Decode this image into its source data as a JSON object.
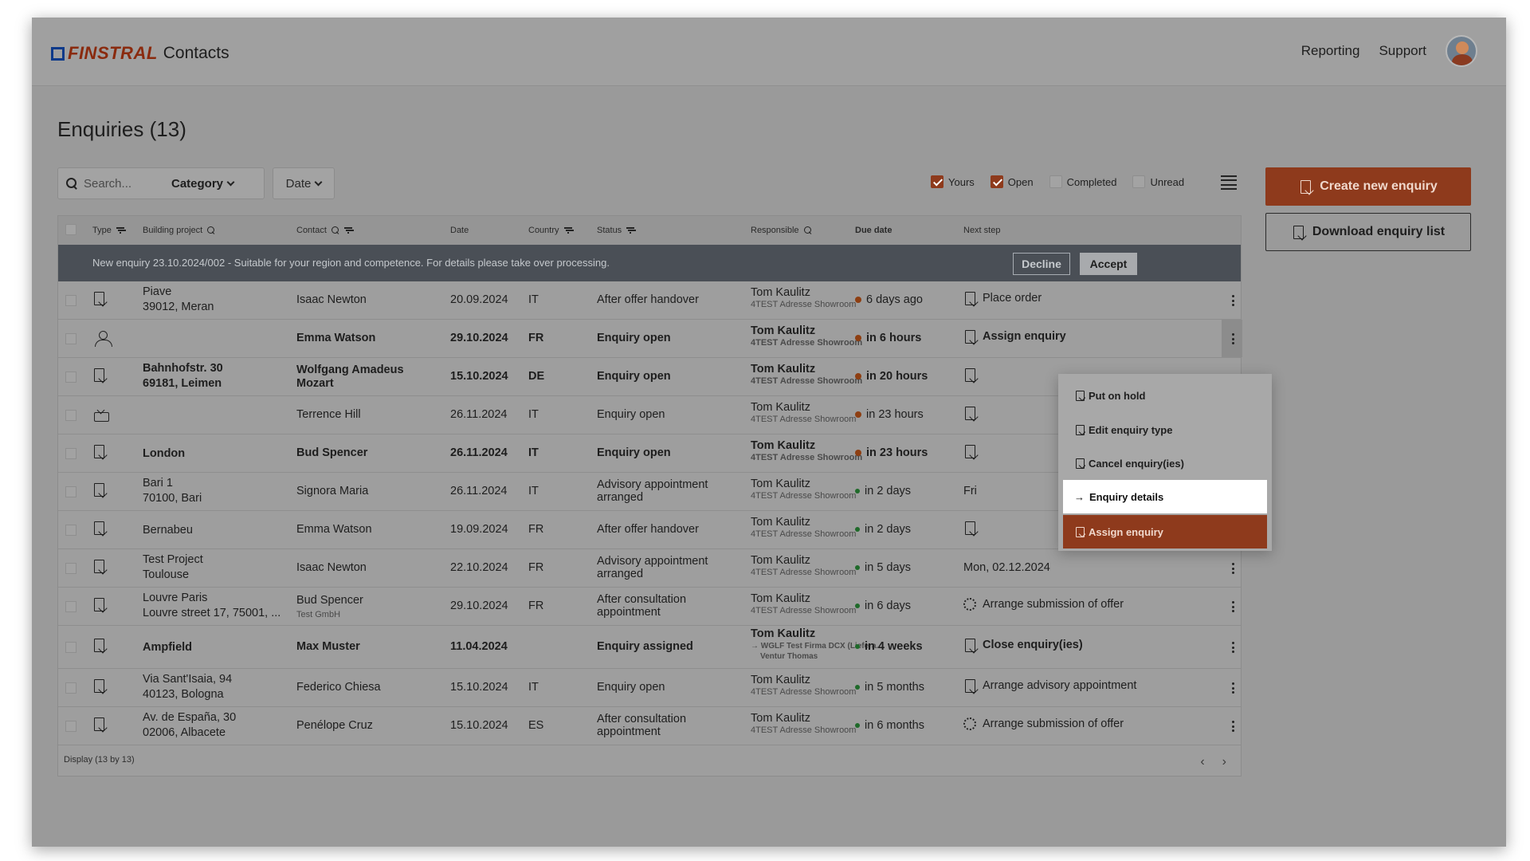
{
  "app": {
    "brand": "FINSTRAL",
    "name": "Contacts"
  },
  "nav": {
    "reporting": "Reporting",
    "support": "Support"
  },
  "page": {
    "title": "Enquiries (13)"
  },
  "filters": {
    "search_placeholder": "Search...",
    "category": "Category",
    "date": "Date",
    "yours": "Yours",
    "open": "Open",
    "completed": "Completed",
    "unread": "Unread"
  },
  "actions": {
    "create": "Create new enquiry",
    "download": "Download enquiry list"
  },
  "columns": {
    "type": "Type",
    "building": "Building project",
    "contact": "Contact",
    "date": "Date",
    "country": "Country",
    "status": "Status",
    "responsible": "Responsible",
    "due": "Due date",
    "next": "Next step"
  },
  "banner": {
    "message": "New enquiry 23.10.2024/002 - Suitable for your region and competence. For details please take over processing.",
    "decline": "Decline",
    "accept": "Accept"
  },
  "rows": [
    {
      "b1": "Piave",
      "b2": "39012, Meran",
      "contact": "Isaac Newton",
      "contact_sub": "",
      "date": "20.09.2024",
      "country": "IT",
      "s1": "After offer handover",
      "s2": "",
      "resp": "Tom Kaulitz",
      "resp_sub": "4TEST Adresse Showroom",
      "due": "6 days ago",
      "next": "Place order"
    },
    {
      "b1": "",
      "b2": "",
      "contact": "Emma Watson",
      "contact_sub": "",
      "date": "29.10.2024",
      "country": "FR",
      "s1": "Enquiry open",
      "s2": "",
      "resp": "Tom Kaulitz",
      "resp_sub": "4TEST Adresse Showroom",
      "due": "in 6 hours",
      "next": "Assign enquiry"
    },
    {
      "b1": "Bahnhofstr. 30",
      "b2": "69181, Leimen",
      "contact": "Wolfgang Amadeus",
      "contact_sub": "Mozart",
      "date": "15.10.2024",
      "country": "DE",
      "s1": "Enquiry open",
      "s2": "",
      "resp": "Tom Kaulitz",
      "resp_sub": "4TEST Adresse Showroom",
      "due": "in 20 hours",
      "next": ""
    },
    {
      "b1": "",
      "b2": "",
      "contact": "Terrence Hill",
      "contact_sub": "",
      "date": "26.11.2024",
      "country": "IT",
      "s1": "Enquiry open",
      "s2": "",
      "resp": "Tom Kaulitz",
      "resp_sub": "4TEST Adresse Showroom",
      "due": "in 23 hours",
      "next": ""
    },
    {
      "b1": "London",
      "b2": "",
      "contact": "Bud Spencer",
      "contact_sub": "",
      "date": "26.11.2024",
      "country": "IT",
      "s1": "Enquiry open",
      "s2": "",
      "resp": "Tom Kaulitz",
      "resp_sub": "4TEST Adresse Showroom",
      "due": "in 23 hours",
      "next": ""
    },
    {
      "b1": "Bari 1",
      "b2": "70100, Bari",
      "contact": "Signora Maria",
      "contact_sub": "",
      "date": "26.11.2024",
      "country": "IT",
      "s1": "Advisory appointment",
      "s2": "arranged",
      "resp": "Tom Kaulitz",
      "resp_sub": "4TEST Adresse Showroom",
      "due": "in 2 days",
      "next": "Fri"
    },
    {
      "b1": "Bernabeu",
      "b2": "",
      "contact": "Emma Watson",
      "contact_sub": "",
      "date": "19.09.2024",
      "country": "FR",
      "s1": "After offer handover",
      "s2": "",
      "resp": "Tom Kaulitz",
      "resp_sub": "4TEST Adresse Showroom",
      "due": "in 2 days",
      "next": ""
    },
    {
      "b1": "Test Project",
      "b2": "Toulouse",
      "contact": "Isaac Newton",
      "contact_sub": "",
      "date": "22.10.2024",
      "country": "FR",
      "s1": "Advisory appointment",
      "s2": "arranged",
      "resp": "Tom Kaulitz",
      "resp_sub": "4TEST Adresse Showroom",
      "due": "in 5 days",
      "next": "Mon, 02.12.2024"
    },
    {
      "b1": "Louvre Paris",
      "b2": "Louvre street 17, 75001, ...",
      "contact": "Bud Spencer",
      "contact_sub": "Test GmbH",
      "date": "29.10.2024",
      "country": "FR",
      "s1": "After consultation",
      "s2": "appointment",
      "resp": "Tom Kaulitz",
      "resp_sub": "4TEST Adresse Showroom",
      "due": "in 6 days",
      "next": "Arrange submission of offer"
    },
    {
      "b1": "Ampfield",
      "b2": "",
      "contact": "Max Muster",
      "contact_sub": "",
      "date": "11.04.2024",
      "country": "",
      "s1": "Enquiry assigned",
      "s2": "",
      "resp": "Tom Kaulitz",
      "resp_sub": "→ WGLF Test Firma DCX (Liefera...",
      "resp_sub2": "Ventur Thomas",
      "due": "in 4 weeks",
      "next": "Close enquiry(ies)"
    },
    {
      "b1": "Via Sant'Isaia, 94",
      "b2": "40123, Bologna",
      "contact": "Federico Chiesa",
      "contact_sub": "",
      "date": "15.10.2024",
      "country": "IT",
      "s1": "Enquiry open",
      "s2": "",
      "resp": "Tom Kaulitz",
      "resp_sub": "4TEST Adresse Showroom",
      "due": "in 5 months",
      "next": "Arrange advisory appointment"
    },
    {
      "b1": "Av. de España, 30",
      "b2": "02006, Albacete",
      "contact": "Penélope Cruz",
      "contact_sub": "",
      "date": "15.10.2024",
      "country": "ES",
      "s1": "After consultation",
      "s2": "appointment",
      "resp": "Tom Kaulitz",
      "resp_sub": "4TEST Adresse Showroom",
      "due": "in 6 months",
      "next": "Arrange submission of offer"
    }
  ],
  "footer": {
    "display": "Display   (13 by 13)"
  },
  "menu": {
    "put_on_hold": "Put on hold",
    "edit_type": "Edit enquiry type",
    "cancel": "Cancel enquiry(ies)",
    "details": "Enquiry details",
    "assign": "Assign enquiry"
  },
  "colors": {
    "accent": "#8e3a1c",
    "brand_blue": "#0d3a8a",
    "due_orange": "#8e3f12",
    "due_green": "#1f6a2a"
  }
}
